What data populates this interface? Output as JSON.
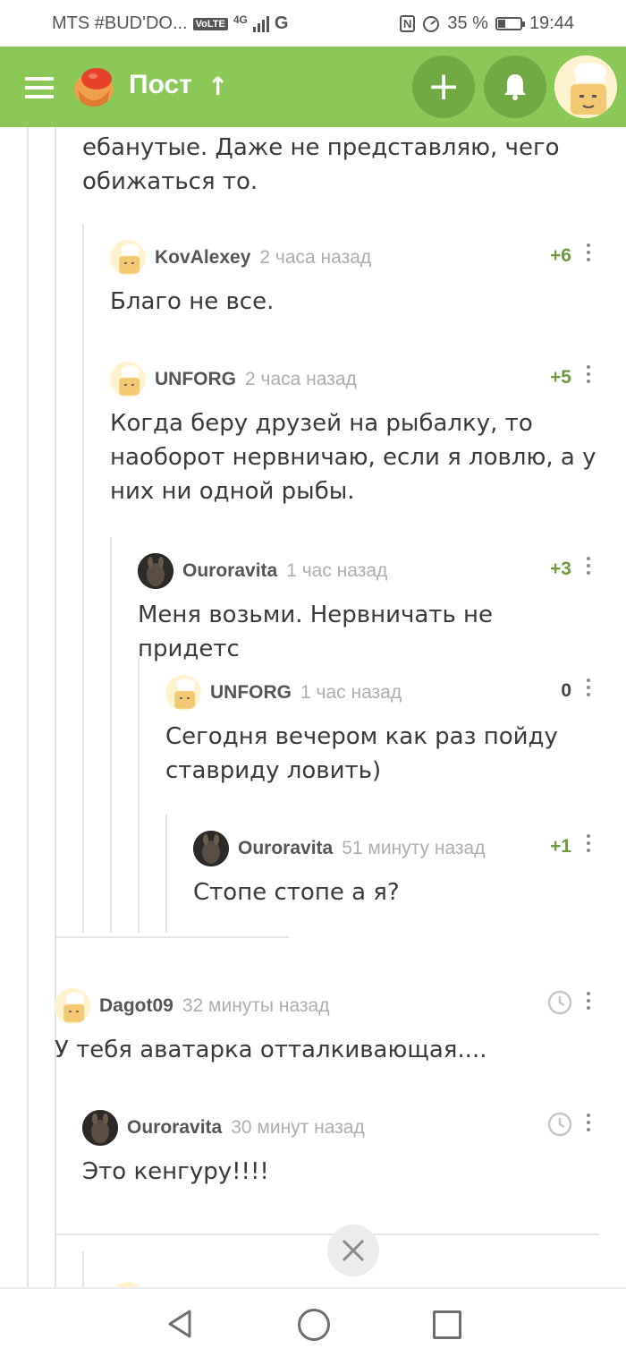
{
  "status_bar": {
    "carrier": "MTS #BUD'DO...",
    "volte": "VoLTE",
    "network": "4G",
    "g_label": "G",
    "nfc": "N",
    "battery_percent": "35 %",
    "battery_level": 0.35,
    "time": "19:44"
  },
  "header": {
    "title": "Пост",
    "icons": {
      "menu": "menu-icon",
      "add": "plus-icon",
      "bell": "bell-icon",
      "scroll_top": "arrow-up-icon"
    },
    "brand_color": "#8ac858"
  },
  "prev_comment_tail": "ебанутые. Даже не представляю, чего\nобижаться то.",
  "comments": [
    {
      "author": "KovAlexey",
      "time": "2 часа назад",
      "rating": "+6",
      "text": "Благо не все."
    },
    {
      "author": "UNFORG",
      "time": "2 часа назад",
      "rating": "+5",
      "text": "Когда беру друзей на рыбалку, то\nнаоборот нервничаю, если я ловлю, а у\nних ни одной рыбы."
    },
    {
      "author": "Ouroravita",
      "time": "1 час назад",
      "rating": "+3",
      "text": "Меня возьми. Нервничать не придетс"
    },
    {
      "author": "UNFORG",
      "time": "1 час назад",
      "rating": "0",
      "text": "Сегодня вечером как раз пойду\nставриду ловить)"
    },
    {
      "author": "Ouroravita",
      "time": "51 минуту назад",
      "rating": "+1",
      "text": "Стопе стопе а я?"
    },
    {
      "author": "Dagot09",
      "time": "32 минуты назад",
      "rating_icon": "clock-icon",
      "text": "У тебя аватарка отталкивающая...."
    },
    {
      "author": "Ouroravita",
      "time": "30 минут назад",
      "rating_icon": "clock-icon",
      "text": "Это кенгуру!!!!"
    }
  ],
  "nav": {
    "back": "back-triangle-icon",
    "home": "home-circle-icon",
    "recent": "recent-square-icon"
  }
}
